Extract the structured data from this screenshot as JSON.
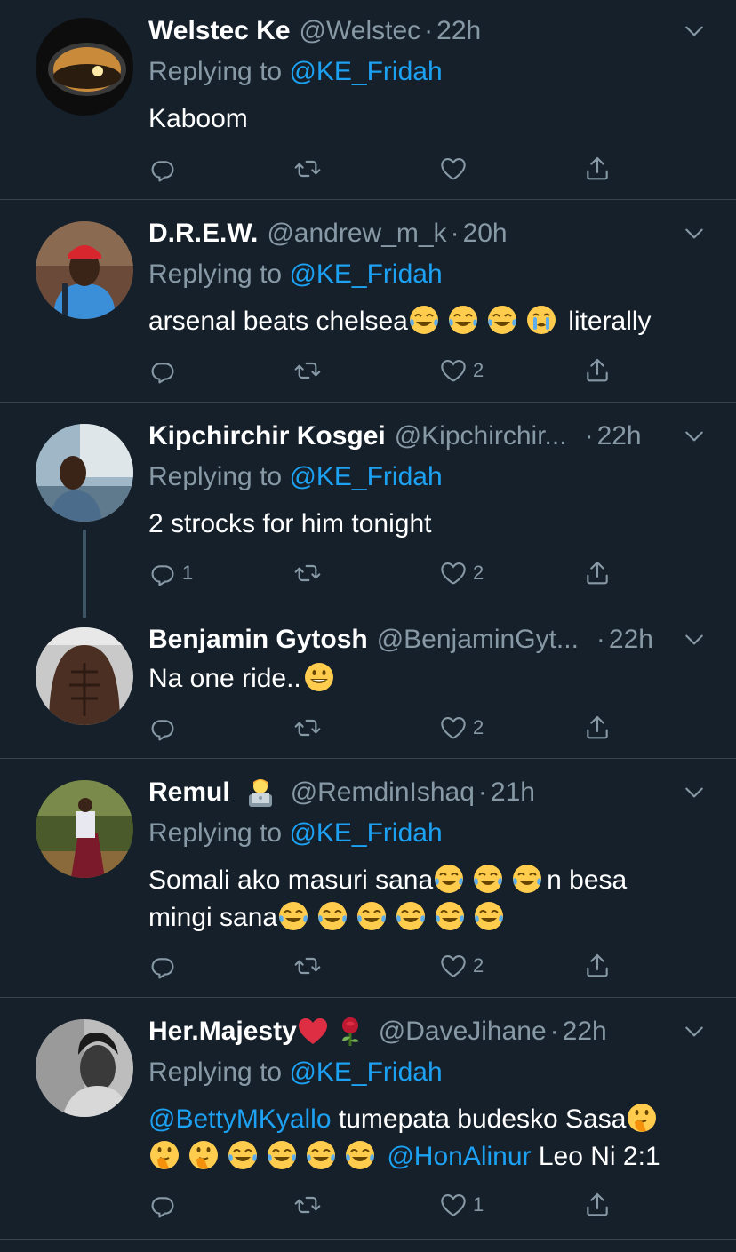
{
  "tweets": [
    {
      "name": "Welstec Ke",
      "handle": "@Welstec",
      "time": "22h",
      "replying_prefix": "Replying to",
      "replying_to": "@KE_Fridah",
      "text": "Kaboom",
      "counts": {
        "reply": "",
        "retweet": "",
        "like": ""
      }
    },
    {
      "name": "D.R.E.W.",
      "handle": "@andrew_m_k",
      "time": "20h",
      "replying_prefix": "Replying to",
      "replying_to": "@KE_Fridah",
      "text": "arsenal beats chelsea",
      "text_after": "literally",
      "counts": {
        "reply": "",
        "retweet": "",
        "like": "2"
      }
    },
    {
      "name": "Kipchirchir Kosgei",
      "handle": "@Kipchirchir...",
      "time": "22h",
      "replying_prefix": "Replying to",
      "replying_to": "@KE_Fridah",
      "text": "2 strocks for him tonight",
      "counts": {
        "reply": "1",
        "retweet": "",
        "like": "2"
      }
    },
    {
      "name": "Benjamin Gytosh",
      "handle": "@BenjaminGyt...",
      "time": "22h",
      "text": "Na one ride..",
      "counts": {
        "reply": "",
        "retweet": "",
        "like": "2"
      }
    },
    {
      "name": "Remul",
      "handle": "@RemdinIshaq",
      "time": "21h",
      "replying_prefix": "Replying to",
      "replying_to": "@KE_Fridah",
      "text": "Somali ako masuri sana",
      "text_mid": "n besa",
      "text_line2": "mingi sana",
      "counts": {
        "reply": "",
        "retweet": "",
        "like": "2"
      }
    },
    {
      "name": "Her.Majesty",
      "handle": "@DaveJihane",
      "time": "22h",
      "replying_prefix": "Replying to",
      "replying_to": "@KE_Fridah",
      "mention1": "@BettyMKyallo",
      "text": "tumepata budesko Sasa",
      "mention2": "@HonAlinur",
      "text_end": "Leo Ni 2:1",
      "counts": {
        "reply": "",
        "retweet": "",
        "like": "1"
      }
    }
  ],
  "icons": {
    "reply": "reply-icon",
    "retweet": "retweet-icon",
    "like": "like-icon",
    "share": "share-icon",
    "caret": "chevron-down-icon"
  },
  "colors": {
    "background": "#15202b",
    "secondary_text": "#8899a6",
    "link": "#1da1f2",
    "divider": "#38444d"
  }
}
